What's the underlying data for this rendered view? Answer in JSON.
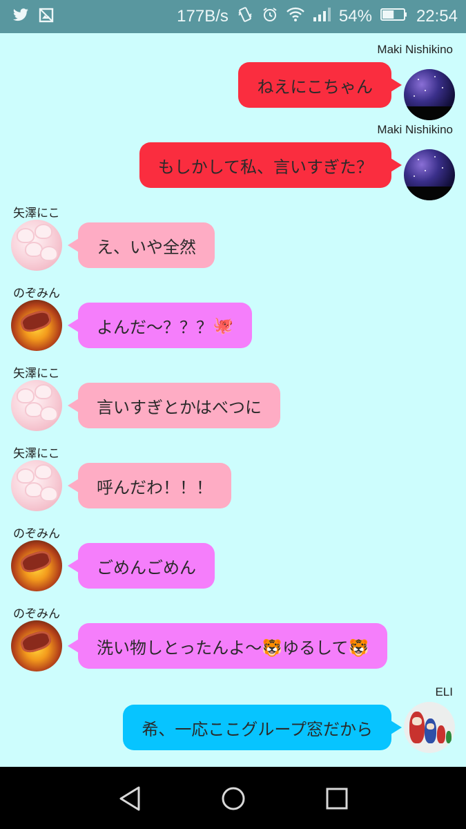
{
  "status_bar": {
    "left_icons": [
      "twitter-icon",
      "image-icon"
    ],
    "network_speed": "177B/s",
    "battery_percent": "54%",
    "battery_level": 0.54,
    "time": "22:54",
    "icons": [
      "vibrate-icon",
      "alarm-icon",
      "wifi-icon",
      "signal-icon",
      "battery-icon"
    ]
  },
  "colors": {
    "background": "#cdfdfd",
    "maki_bubble": "#fa2d3f",
    "nico_bubble": "#feacc4",
    "nozomi_bubble": "#f57efb",
    "eli_bubble": "#07c4ff"
  },
  "messages": [
    {
      "sender": "Maki Nishikino",
      "side": "right",
      "text": "ねえにこちゃん"
    },
    {
      "sender": "Maki Nishikino",
      "side": "right",
      "text": "もしかして私、言いすぎた？"
    },
    {
      "sender": "矢澤にこ",
      "side": "left",
      "text": "え、いや全然"
    },
    {
      "sender": "のぞみん",
      "side": "left",
      "text": "よんだ～？？？",
      "emoji": "🐙"
    },
    {
      "sender": "矢澤にこ",
      "side": "left",
      "text": "言いすぎとかはべつに"
    },
    {
      "sender": "矢澤にこ",
      "side": "left",
      "text": "呼んだわ！！！"
    },
    {
      "sender": "のぞみん",
      "side": "left",
      "text": "ごめんごめん"
    },
    {
      "sender": "のぞみん",
      "side": "left",
      "text": "洗い物しとったんよ～🐯ゆるして🐯"
    },
    {
      "sender": "ELI",
      "side": "right",
      "text": "希、一応ここグループ窓だから"
    }
  ],
  "nav_bar": {
    "buttons": [
      "back-icon",
      "home-icon",
      "recents-icon"
    ]
  }
}
